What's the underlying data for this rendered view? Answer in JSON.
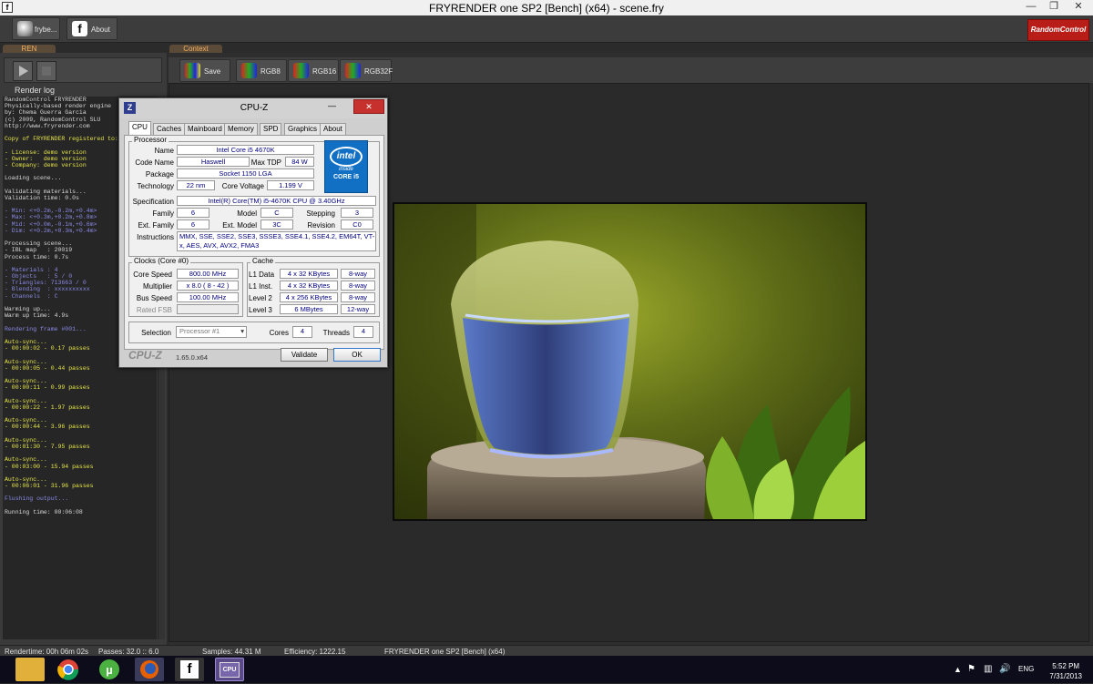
{
  "window": {
    "title": "FRYRENDER one SP2 [Bench] (x64) - scene.fry",
    "app_icon": "f"
  },
  "toolbar": {
    "frybench_label": "frybe...",
    "about_label": "About",
    "brand_logo": "RandomControl"
  },
  "render_panel": {
    "tab": "REN",
    "log_title": "Render log",
    "log_lines": [
      {
        "text": "RandomControl FRYRENDER",
        "c": "w"
      },
      {
        "text": "Physically-based render engine",
        "c": "w"
      },
      {
        "text": "by: Chema Guerra Garcia",
        "c": "w"
      },
      {
        "text": "(c) 2009, RandomControl SLU",
        "c": "w"
      },
      {
        "text": "http://www.fryrender.com",
        "c": "w"
      },
      {
        "text": "",
        "c": "w"
      },
      {
        "text": "Copy of FRYRENDER registered to:",
        "c": "y"
      },
      {
        "text": "",
        "c": "w"
      },
      {
        "text": "- License: demo version",
        "c": "y"
      },
      {
        "text": "- Owner:   demo version",
        "c": "y"
      },
      {
        "text": "- Company: demo version",
        "c": "y"
      },
      {
        "text": "",
        "c": "w"
      },
      {
        "text": "Loading scene...",
        "c": "w"
      },
      {
        "text": "",
        "c": "w"
      },
      {
        "text": "Validating materials...",
        "c": "w"
      },
      {
        "text": "Validation time: 0.0s",
        "c": "w"
      },
      {
        "text": "",
        "c": "w"
      },
      {
        "text": "- Min: <+0.2m,-0.2m,+0.4m>",
        "c": "b"
      },
      {
        "text": "- Max: <+0.3m,+0.2m,+0.8m>",
        "c": "b"
      },
      {
        "text": "- Mid: <+0.0m,-0.1m,+0.6m>",
        "c": "b"
      },
      {
        "text": "- Dim: <+0.2m,+0.3m,+0.4m>",
        "c": "b"
      },
      {
        "text": "",
        "c": "w"
      },
      {
        "text": "Processing scene...",
        "c": "w"
      },
      {
        "text": "- IBL map   : 20019",
        "c": "w"
      },
      {
        "text": "Process time: 0.7s",
        "c": "w"
      },
      {
        "text": "",
        "c": "w"
      },
      {
        "text": "- Materials : 4",
        "c": "b"
      },
      {
        "text": "- Objects   : 5 / 0",
        "c": "b"
      },
      {
        "text": "- Triangles: 713663 / 0",
        "c": "b"
      },
      {
        "text": "- Blending  : xxxxxxxxxx",
        "c": "b"
      },
      {
        "text": "- Channels  : C",
        "c": "b"
      },
      {
        "text": "",
        "c": "w"
      },
      {
        "text": "Warming up...",
        "c": "w"
      },
      {
        "text": "Warm up time: 4.9s",
        "c": "w"
      },
      {
        "text": "",
        "c": "w"
      },
      {
        "text": "Rendering frame #001...",
        "c": "b"
      },
      {
        "text": "",
        "c": "w"
      },
      {
        "text": "Auto-sync...",
        "c": "y"
      },
      {
        "text": "- 00:00:02 - 0.17 passes",
        "c": "y"
      },
      {
        "text": "",
        "c": "w"
      },
      {
        "text": "Auto-sync...",
        "c": "y"
      },
      {
        "text": "- 00:00:05 - 0.44 passes",
        "c": "y"
      },
      {
        "text": "",
        "c": "w"
      },
      {
        "text": "Auto-sync...",
        "c": "y"
      },
      {
        "text": "- 00:00:11 - 0.99 passes",
        "c": "y"
      },
      {
        "text": "",
        "c": "w"
      },
      {
        "text": "Auto-sync...",
        "c": "y"
      },
      {
        "text": "- 00:00:22 - 1.97 passes",
        "c": "y"
      },
      {
        "text": "",
        "c": "w"
      },
      {
        "text": "Auto-sync...",
        "c": "y"
      },
      {
        "text": "- 00:00:44 - 3.96 passes",
        "c": "y"
      },
      {
        "text": "",
        "c": "w"
      },
      {
        "text": "Auto-sync...",
        "c": "y"
      },
      {
        "text": "- 00:01:30 - 7.95 passes",
        "c": "y"
      },
      {
        "text": "",
        "c": "w"
      },
      {
        "text": "Auto-sync...",
        "c": "y"
      },
      {
        "text": "- 00:03:00 - 15.94 passes",
        "c": "y"
      },
      {
        "text": "",
        "c": "w"
      },
      {
        "text": "Auto-sync...",
        "c": "y"
      },
      {
        "text": "- 00:06:01 - 31.96 passes",
        "c": "y"
      },
      {
        "text": "",
        "c": "w"
      },
      {
        "text": "Flushing output...",
        "c": "b"
      },
      {
        "text": "",
        "c": "w"
      },
      {
        "text": "Running time: 00:06:08",
        "c": "w"
      }
    ]
  },
  "context_panel": {
    "tab": "Context",
    "save_label": "Save",
    "rgb8_label": "RGB8",
    "rgb16_label": "RGB16",
    "rgb32f_label": "RGB32F"
  },
  "statusbar": {
    "rendertime": "Rendertime:  00h 06m 02s",
    "passes": "Passes:  32.0 :: 6.0",
    "samples": "Samples:  44.31 M",
    "efficiency": "Efficiency:  1222.15",
    "app": "FRYRENDER one SP2 [Bench] (x64)"
  },
  "taskbar": {
    "language": "ENG",
    "time": "5:52 PM",
    "date": "7/31/2013"
  },
  "cpuz": {
    "title": "CPU-Z",
    "tabs": [
      "CPU",
      "Caches",
      "Mainboard",
      "Memory",
      "SPD",
      "Graphics",
      "About"
    ],
    "processor_group": "Processor",
    "labels": {
      "name": "Name",
      "code_name": "Code Name",
      "max_tdp": "Max TDP",
      "package": "Package",
      "technology": "Technology",
      "core_voltage": "Core Voltage",
      "specification": "Specification",
      "family": "Family",
      "model": "Model",
      "stepping": "Stepping",
      "ext_family": "Ext. Family",
      "ext_model": "Ext. Model",
      "revision": "Revision",
      "instructions": "Instructions"
    },
    "values": {
      "name": "Intel Core i5 4670K",
      "code_name": "Haswell",
      "max_tdp": "84 W",
      "package": "Socket 1150 LGA",
      "technology": "22 nm",
      "core_voltage": "1.199 V",
      "specification": "Intel(R) Core(TM) i5-4670K CPU @ 3.40GHz",
      "family": "6",
      "model": "C",
      "stepping": "3",
      "ext_family": "6",
      "ext_model": "3C",
      "revision": "C0",
      "instructions": "MMX, SSE, SSE2, SSE3, SSSE3, SSE4.1, SSE4.2, EM64T, VT-x, AES, AVX, AVX2, FMA3"
    },
    "intel_badge": {
      "brand": "intel",
      "inside": "inside",
      "core": "CORE i5"
    },
    "clocks": {
      "group": "Clocks (Core #0)",
      "core_speed_label": "Core Speed",
      "core_speed": "800.00 MHz",
      "multiplier_label": "Multiplier",
      "multiplier": "x 8.0 ( 8 - 42 )",
      "bus_speed_label": "Bus Speed",
      "bus_speed": "100.00 MHz",
      "rated_fsb_label": "Rated FSB",
      "rated_fsb": ""
    },
    "cache": {
      "group": "Cache",
      "rows": [
        {
          "label": "L1 Data",
          "size": "4 x 32 KBytes",
          "way": "8-way"
        },
        {
          "label": "L1 Inst.",
          "size": "4 x 32 KBytes",
          "way": "8-way"
        },
        {
          "label": "Level 2",
          "size": "4 x 256 KBytes",
          "way": "8-way"
        },
        {
          "label": "Level 3",
          "size": "6 MBytes",
          "way": "12-way"
        }
      ]
    },
    "selection_label": "Selection",
    "selection": "Processor #1",
    "cores_label": "Cores",
    "cores": "4",
    "threads_label": "Threads",
    "threads": "4",
    "brand": "CPU-Z",
    "version": "1.65.0.x64",
    "validate_label": "Validate",
    "ok_label": "OK"
  },
  "colors": {
    "log_yellow": "#e6e64a",
    "log_blue": "#8a8ae6",
    "log_white": "#d8d8d8",
    "close_red": "#c7312d",
    "intel_blue": "#1170c4"
  }
}
